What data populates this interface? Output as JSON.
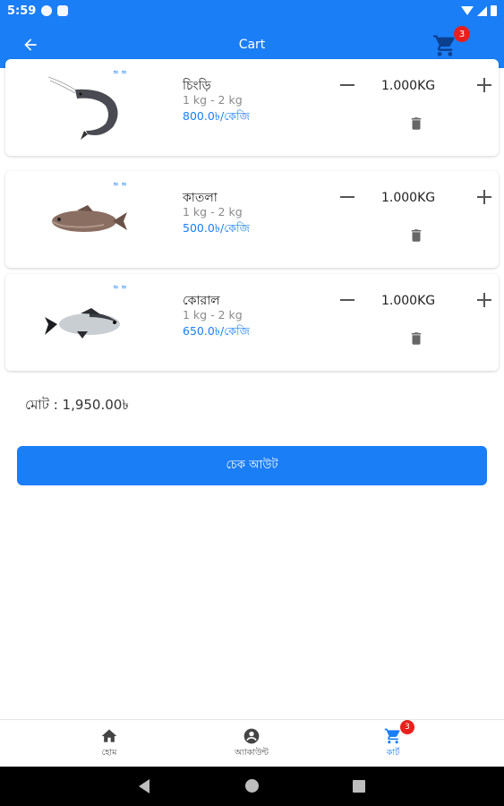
{
  "status_bar": {
    "time": "5:59"
  },
  "app_bar": {
    "title": "Cart",
    "cart_count": "3"
  },
  "cart_items": [
    {
      "name": "চিংড়ি",
      "weight": "1 kg - 2 kg",
      "price": "800.0৳/কেজি",
      "quantity": "1.000KG",
      "image": "shrimp"
    },
    {
      "name": "কাতলা",
      "weight": "1 kg - 2 kg",
      "price": "500.0৳/কেজি",
      "quantity": "1.000KG",
      "image": "catla-fish"
    },
    {
      "name": "কোরাল",
      "weight": "1 kg - 2 kg",
      "price": "650.0৳/কেজি",
      "quantity": "1.000KG",
      "image": "coral-fish"
    }
  ],
  "total": {
    "label": "মোট : 1,950.00৳"
  },
  "checkout": {
    "label": "চেক আউট"
  },
  "bottom_nav": {
    "items": [
      {
        "label": "হোম",
        "icon": "home-icon"
      },
      {
        "label": "অ্যাকাউন্ট",
        "icon": "account-icon"
      },
      {
        "label": "কার্ট",
        "icon": "cart-icon",
        "badge": "3",
        "active": true
      }
    ]
  },
  "colors": {
    "primary": "#1a7ef6",
    "badge": "#e8201c",
    "price": "#1a7ef6"
  }
}
